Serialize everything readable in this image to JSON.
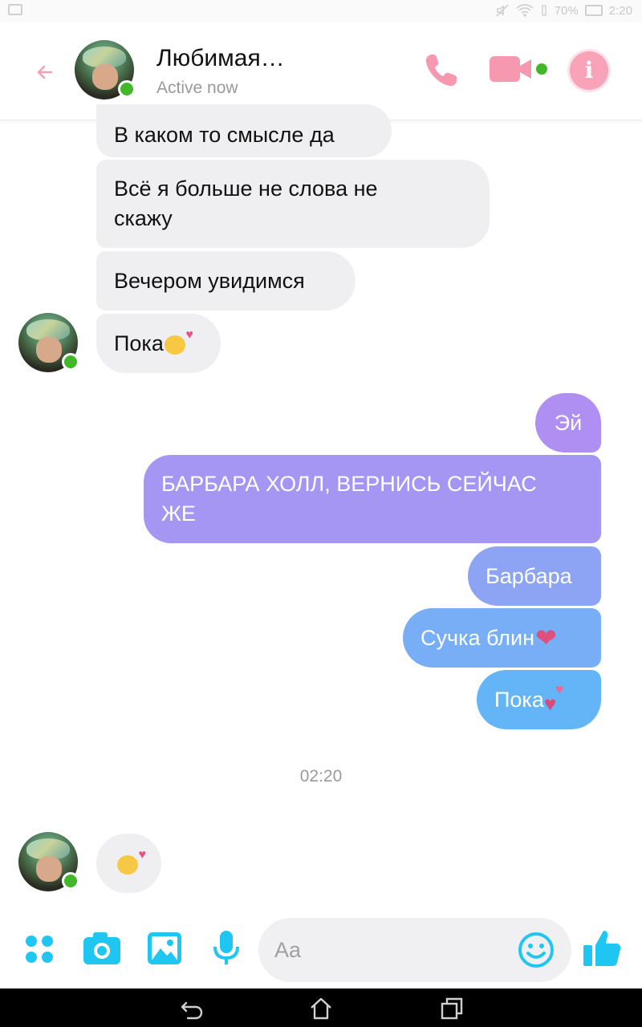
{
  "status_bar": {
    "battery": "70%",
    "time": "2:20"
  },
  "header": {
    "contact_name": "Любимая…",
    "contact_status": "Active now"
  },
  "messages": {
    "m1": "В каком то смысле да",
    "m2_line1": "Всё я больше не слова не",
    "m2_line2": "скажу",
    "m3": "Вечером увидимся",
    "m4": "Пока",
    "o1": "Эй",
    "o2_line1": "БАРБАРА ХОЛЛ, ВЕРНИСЬ СЕЙЧАС",
    "o2_line2": "ЖЕ",
    "o3": "Барбара",
    "o4": "Сучка блин",
    "o5": "Пока"
  },
  "timestamp": "02:20",
  "composer": {
    "placeholder": "Aa"
  },
  "icons": {
    "back": "back-arrow-icon",
    "call": "phone-icon",
    "video": "video-camera-icon",
    "info": "info-icon",
    "menu": "four-dots-icon",
    "camera": "camera-icon",
    "gallery": "image-icon",
    "mic": "microphone-icon",
    "emoji": "smiley-icon",
    "like": "thumbs-up-icon"
  },
  "colors": {
    "accent_pink": "#f8a3b8",
    "accent_cyan": "#1fc6f1",
    "online_green": "#42b72a",
    "bubble_in": "#efeff1",
    "gradient_top": "#b28ef2",
    "gradient_bottom": "#62b6f7"
  }
}
